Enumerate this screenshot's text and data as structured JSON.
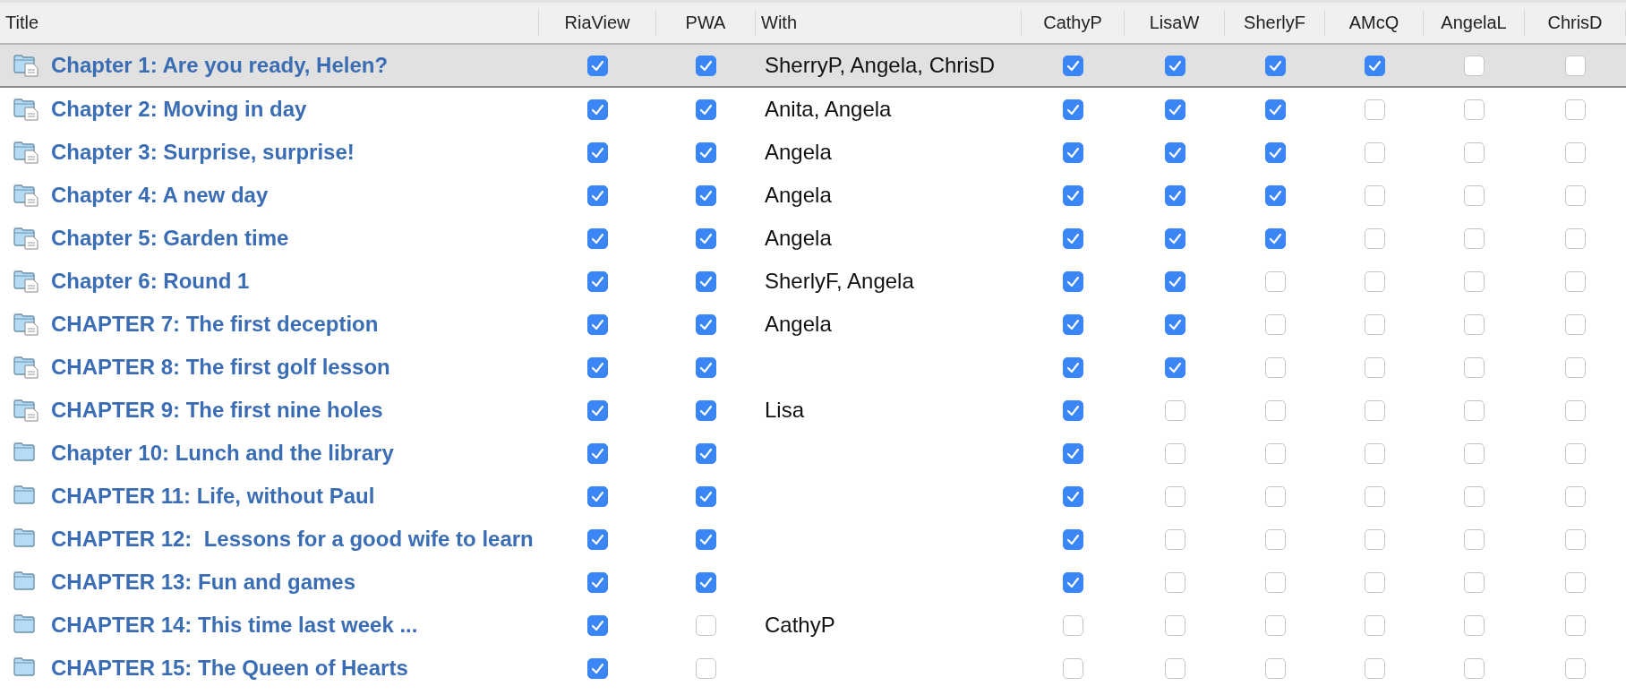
{
  "columns": [
    {
      "label": "Title",
      "kind": "title"
    },
    {
      "label": "RiaView",
      "kind": "check"
    },
    {
      "label": "PWA",
      "kind": "check"
    },
    {
      "label": "With",
      "kind": "text"
    },
    {
      "label": "CathyP",
      "kind": "check"
    },
    {
      "label": "LisaW",
      "kind": "check"
    },
    {
      "label": "SherlyF",
      "kind": "check"
    },
    {
      "label": "AMcQ",
      "kind": "check"
    },
    {
      "label": "AngelaL",
      "kind": "check"
    },
    {
      "label": "ChrisD",
      "kind": "check"
    }
  ],
  "rows": [
    {
      "title": "Chapter 1: Are you ready, Helen?",
      "kind": "folder-doc",
      "selected": true,
      "with": "SherryP, Angela, ChrisD",
      "checks": [
        {
          "checked": true
        },
        {
          "checked": true
        },
        {
          "checked": true
        },
        {
          "checked": true
        },
        {
          "checked": true
        },
        {
          "checked": true
        },
        {
          "checked": false
        },
        {
          "checked": false
        }
      ]
    },
    {
      "title": "Chapter 2: Moving in day",
      "kind": "folder-doc",
      "selected": false,
      "with": "Anita, Angela",
      "checks": [
        {
          "checked": true
        },
        {
          "checked": true
        },
        {
          "checked": true
        },
        {
          "checked": true
        },
        {
          "checked": true
        },
        {
          "checked": false
        },
        {
          "checked": false
        },
        {
          "checked": false
        }
      ]
    },
    {
      "title": "Chapter 3: Surprise, surprise!",
      "kind": "folder-doc",
      "selected": false,
      "with": "Angela",
      "checks": [
        {
          "checked": true
        },
        {
          "checked": true
        },
        {
          "checked": true
        },
        {
          "checked": true
        },
        {
          "checked": true
        },
        {
          "checked": false
        },
        {
          "checked": false
        },
        {
          "checked": false
        }
      ]
    },
    {
      "title": "Chapter 4: A new day",
      "kind": "folder-doc",
      "selected": false,
      "with": "Angela",
      "checks": [
        {
          "checked": true
        },
        {
          "checked": true
        },
        {
          "checked": true
        },
        {
          "checked": true
        },
        {
          "checked": true
        },
        {
          "checked": false
        },
        {
          "checked": false
        },
        {
          "checked": false
        }
      ]
    },
    {
      "title": "Chapter 5: Garden time",
      "kind": "folder-doc",
      "selected": false,
      "with": "Angela",
      "checks": [
        {
          "checked": true
        },
        {
          "checked": true
        },
        {
          "checked": true
        },
        {
          "checked": true
        },
        {
          "checked": true
        },
        {
          "checked": false
        },
        {
          "checked": false
        },
        {
          "checked": false
        }
      ]
    },
    {
      "title": "Chapter 6: Round 1",
      "kind": "folder-doc",
      "selected": false,
      "with": "SherlyF, Angela",
      "checks": [
        {
          "checked": true
        },
        {
          "checked": true
        },
        {
          "checked": true
        },
        {
          "checked": true
        },
        {
          "checked": false
        },
        {
          "checked": false
        },
        {
          "checked": false
        },
        {
          "checked": false
        }
      ]
    },
    {
      "title": "CHAPTER 7: The first deception",
      "kind": "folder-doc",
      "selected": false,
      "with": "Angela",
      "checks": [
        {
          "checked": true
        },
        {
          "checked": true
        },
        {
          "checked": true
        },
        {
          "checked": true
        },
        {
          "checked": false
        },
        {
          "checked": false
        },
        {
          "checked": false
        },
        {
          "checked": false
        }
      ]
    },
    {
      "title": "CHAPTER 8: The first golf lesson",
      "kind": "folder-doc",
      "selected": false,
      "checks": [
        {
          "checked": true
        },
        {
          "checked": true
        },
        {
          "checked": true
        },
        {
          "checked": true
        },
        {
          "checked": false
        },
        {
          "checked": false
        },
        {
          "checked": false
        },
        {
          "checked": false
        }
      ]
    },
    {
      "title": "CHAPTER 9: The first nine holes",
      "kind": "folder-doc",
      "selected": false,
      "with": "Lisa",
      "checks": [
        {
          "checked": true
        },
        {
          "checked": true
        },
        {
          "checked": true
        },
        {
          "checked": false
        },
        {
          "checked": false
        },
        {
          "checked": false
        },
        {
          "checked": false
        },
        {
          "checked": false
        }
      ]
    },
    {
      "title": "Chapter 10: Lunch and the library",
      "kind": "folder",
      "selected": false,
      "checks": [
        {
          "checked": true
        },
        {
          "checked": true
        },
        {
          "checked": true
        },
        {
          "checked": false
        },
        {
          "checked": false
        },
        {
          "checked": false
        },
        {
          "checked": false
        },
        {
          "checked": false
        }
      ]
    },
    {
      "title": "CHAPTER 11: Life, without Paul",
      "kind": "folder",
      "selected": false,
      "checks": [
        {
          "checked": true
        },
        {
          "checked": true
        },
        {
          "checked": true
        },
        {
          "checked": false
        },
        {
          "checked": false
        },
        {
          "checked": false
        },
        {
          "checked": false
        },
        {
          "checked": false
        }
      ]
    },
    {
      "title": "CHAPTER 12:  Lessons for a good wife to learn",
      "kind": "folder",
      "selected": false,
      "checks": [
        {
          "checked": true
        },
        {
          "checked": true
        },
        {
          "checked": true
        },
        {
          "checked": false
        },
        {
          "checked": false
        },
        {
          "checked": false
        },
        {
          "checked": false
        },
        {
          "checked": false
        }
      ]
    },
    {
      "title": "CHAPTER 13: Fun and games",
      "kind": "folder",
      "selected": false,
      "checks": [
        {
          "checked": true
        },
        {
          "checked": true
        },
        {
          "checked": true
        },
        {
          "checked": false
        },
        {
          "checked": false
        },
        {
          "checked": false
        },
        {
          "checked": false
        },
        {
          "checked": false
        }
      ]
    },
    {
      "title": "CHAPTER 14: This time last week ...",
      "kind": "folder",
      "selected": false,
      "with": "CathyP",
      "checks": [
        {
          "checked": true
        },
        {
          "checked": false
        },
        {
          "checked": false
        },
        {
          "checked": false
        },
        {
          "checked": false
        },
        {
          "checked": false
        },
        {
          "checked": false
        },
        {
          "checked": false
        }
      ]
    },
    {
      "title": "CHAPTER 15: The Queen of Hearts",
      "kind": "folder",
      "selected": false,
      "checks": [
        {
          "checked": true
        },
        {
          "checked": false
        },
        {
          "checked": false
        },
        {
          "checked": false
        },
        {
          "checked": false
        },
        {
          "checked": false
        },
        {
          "checked": false
        },
        {
          "checked": false
        }
      ]
    }
  ]
}
